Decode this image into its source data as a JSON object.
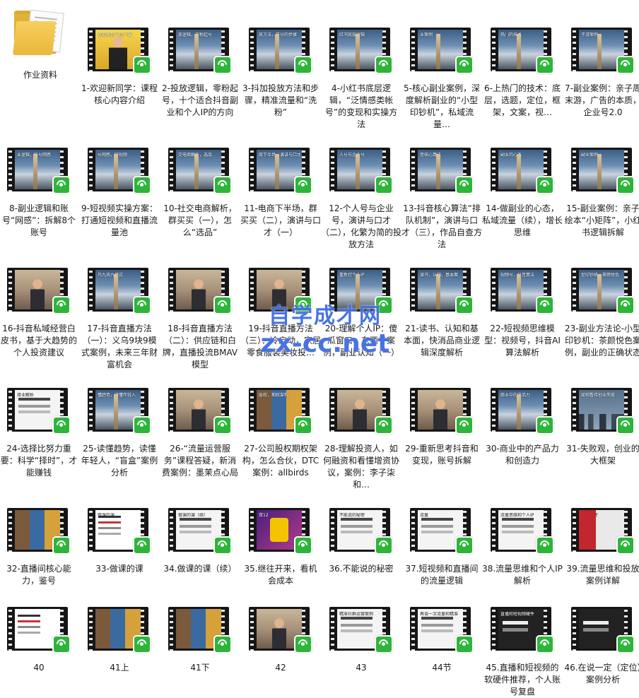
{
  "folder": {
    "label": "作业资料",
    "icon": "folder-icon"
  },
  "videos": [
    {
      "label": "1-欢迎新同学：课程核心内容介绍",
      "thumb": "yellow",
      "thumb_text": "欢迎来到一起一课"
    },
    {
      "label": "2-投放逻辑，零粉起号，十个适合抖音副业和个人IP的方向",
      "thumb": "city",
      "thumb_text": "放逻辑，零粉起号"
    },
    {
      "label": "3-抖加投放方法和步骤，精准流量和“洗粉”",
      "thumb": "city",
      "thumb_text": "放方法，开分的步骤"
    },
    {
      "label": "4-小红书底层逻辑，“泛情感类帐号”的变现和实操方法",
      "thumb": "city",
      "thumb_text": "红书底层逻辑"
    },
    {
      "label": "5-核心副业案例，深度解析副业的“小型印钞机”，私域流量…",
      "thumb": "city",
      "thumb_text": "业案例"
    },
    {
      "label": "6-上热门的技术：底层，选题，定位，框架，文案，视…",
      "thumb": "city",
      "thumb_text": "热门的技术"
    },
    {
      "label": "7-副业案例：亲子周末游，广告的本质，企业号2.0",
      "thumb": "city",
      "thumb_text": "子游案例"
    },
    {
      "label": "8-副业逻辑和账号“网感”：拆解8个账号",
      "thumb": "city",
      "thumb_text": "业逻辑，账号网感"
    },
    {
      "label": "9-短视频实操方案：打通短视频和直播流量池",
      "thumb": "city",
      "thumb_text": "号网感，短视频"
    },
    {
      "label": "10-社交电商解析，群买买（一），怎么“选品”",
      "thumb": "city",
      "thumb_text": "交电商解析，选品"
    },
    {
      "label": "11-电商下半场，群买买（二），演讲与口才（一）",
      "thumb": "city",
      "thumb_text": "商下半场，演讲与口才"
    },
    {
      "label": "12-个人号与企业号，演讲与口才（二），化繁为简的投放方法",
      "thumb": "city",
      "thumb_text": "人号与企业号"
    },
    {
      "label": "13-抖音核心算法“排队机制”，演讲与口才（三），作品自查方法",
      "thumb": "city",
      "thumb_text": "音核心算法"
    },
    {
      "label": "14-做副业的心态，私域流量（续），增长思维",
      "thumb": "city",
      "thumb_text": "副业的心态"
    },
    {
      "label": "15-副业案例：亲子绘本“小矩阵”，小红书逻辑拆解",
      "thumb": "city",
      "thumb_text": "副业案例"
    },
    {
      "label": "16-抖音私域经营白皮书，基于大趋势的个人投资建议",
      "thumb": "person",
      "thumb_text": ""
    },
    {
      "label": "17-抖音直播方法（一）：义乌9块9模式案例，未来三年财富机会",
      "thumb": "city",
      "thumb_text": "乌九块九模式"
    },
    {
      "label": "18-抖音直播方法（二）：供应链和白牌，直播投流BMAV模型",
      "thumb": "person",
      "thumb_text": ""
    },
    {
      "label": "19-抖音直播方法（三）：冷启动，家居零食服装美妆投…",
      "thumb": "person",
      "thumb_text": ""
    },
    {
      "label": "20-理解个人IP：傻瓜窗口，东西子案例，副业认知（一）",
      "thumb": "city",
      "thumb_text": "重新打个人IP"
    },
    {
      "label": "21-读书、认知和基本面，快消品商业逻辑深度解析",
      "thumb": "city",
      "thumb_text": "读书，认知，基本面"
    },
    {
      "label": "22-短视频思维模型：视频号，抖音AI算法解析",
      "thumb": "city",
      "thumb_text": "视频号，抖音算法"
    },
    {
      "label": "23-副业方法论-小型印钞机：茶颜悦色案例，副业的正确状态",
      "thumb": "city",
      "thumb_text": "型印钞机，茶颜悦色"
    },
    {
      "label": "24-选择比努力重要：科学“择时”，才能赚钱",
      "thumb": "slide",
      "thumb_text": "择业解析"
    },
    {
      "label": "25-读懂趋势，读懂年轻人，“盲盒”案例分析",
      "thumb": "city",
      "thumb_text": "懂趋势，读懂年轻人"
    },
    {
      "label": "26-“流量运营服务”课程答疑，新消费案例：墨茉点心局",
      "thumb": "person",
      "thumb_text": ""
    },
    {
      "label": "27-公司股权期权架构，怎么合伙，DTC案例：allbirds",
      "thumb": "collage",
      "thumb_text": "股权，期权架构"
    },
    {
      "label": "28-理解投资人，如何融资和看懂增资协议，案例：李子柒和…",
      "thumb": "person",
      "thumb_text": ""
    },
    {
      "label": "29-重新思考抖音和变现，账号拆解",
      "thumb": "person",
      "thumb_text": ""
    },
    {
      "label": "30-商业中的产品力和创造力",
      "thumb": "city",
      "thumb_text": "商业中的产品力"
    },
    {
      "label": "31-失败观，创业的大框架",
      "thumb": "bluegrey",
      "thumb_text": "如何看待创业失败"
    },
    {
      "label": "32-直播间核心能力，鉴号",
      "thumb": "collage",
      "thumb_text": ""
    },
    {
      "label": "33-做课的课",
      "thumb": "doc",
      "thumb_text": "做课的课"
    },
    {
      "label": "34.做课的课（续）",
      "thumb": "slide",
      "thumb_text": "做课的课（续）"
    },
    {
      "label": "35.继往开来，看机会成本",
      "thumb": "purple",
      "thumb_text": "双12"
    },
    {
      "label": "36.不能说的秘密",
      "thumb": "slide",
      "thumb_text": "不能说的秘密"
    },
    {
      "label": "37.短视频和直播间的流量逻辑",
      "thumb": "slide",
      "thumb_text": "流量"
    },
    {
      "label": "38.流量思维和个人IP解析",
      "thumb": "slide",
      "thumb_text": "流量思维和个人IP"
    },
    {
      "label": "39.流量思维和投放案例详解",
      "thumb": "red",
      "thumb_text": "流量思考"
    },
    {
      "label": "40",
      "thumb": "doc",
      "thumb_text": ""
    },
    {
      "label": "41上",
      "thumb": "collage",
      "thumb_text": ""
    },
    {
      "label": "41下",
      "thumb": "collage",
      "thumb_text": ""
    },
    {
      "label": "42",
      "thumb": "person",
      "thumb_text": ""
    },
    {
      "label": "43",
      "thumb": "slide",
      "thumb_text": "精准社群运营案例"
    },
    {
      "label": "44节",
      "thumb": "slide",
      "thumb_text": "再谈一次流量和精准"
    },
    {
      "label": "45.直播和短视频的软硬件推荐，个人账号复盘",
      "thumb": "dark",
      "thumb_text": "直播和短视频硬件"
    },
    {
      "label": "46.在说一定（定位）案例分析",
      "thumb": "dark",
      "thumb_text": ""
    }
  ],
  "watermark": {
    "line1": "自学成才网",
    "line2": "zx-cc.net"
  },
  "colors": {
    "badge": "#2fb43b",
    "label_text": "#1a1a1a",
    "watermark": "#285adc"
  }
}
